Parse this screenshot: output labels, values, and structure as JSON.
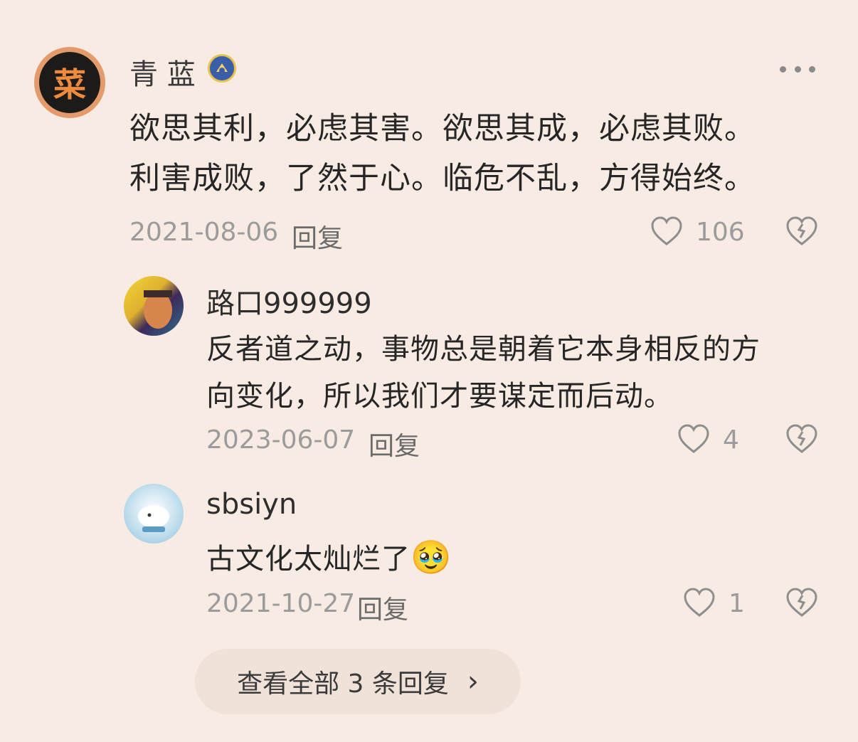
{
  "main_comment": {
    "avatar_char": "菜",
    "username": "青 蓝",
    "text_line1": "欲思其利，必虑其害。欲思其成，必虑其败。",
    "text_line2": "利害成败，了然于心。临危不乱，方得始终。",
    "date": "2021-08-06",
    "reply_label": "回复",
    "like_count": "106"
  },
  "replies": [
    {
      "username": "路口999999",
      "text_line1": "反者道之动，事物总是朝着它本身相反的方",
      "text_line2": "向变化，所以我们才要谋定而后动。",
      "date": "2023-06-07",
      "reply_label": "回复",
      "like_count": "4"
    },
    {
      "username": "sbsiyn",
      "text_line1": "古文化太灿烂了",
      "emoji": "🥹",
      "date": "2021-10-27",
      "reply_label": "回复",
      "like_count": "1"
    }
  ],
  "view_all": {
    "label": "查看全部 3 条回复",
    "chevron": "›"
  },
  "icons": {
    "more": "more-dots-icon",
    "like": "heart-outline-icon",
    "dislike": "broken-heart-icon",
    "badge": "verified-badge-icon"
  },
  "colors": {
    "background": "#f7ebe3",
    "avatar_ring": "#e39b6b",
    "avatar_text": "#ee8b3f",
    "muted_text": "#9b9b9b"
  }
}
